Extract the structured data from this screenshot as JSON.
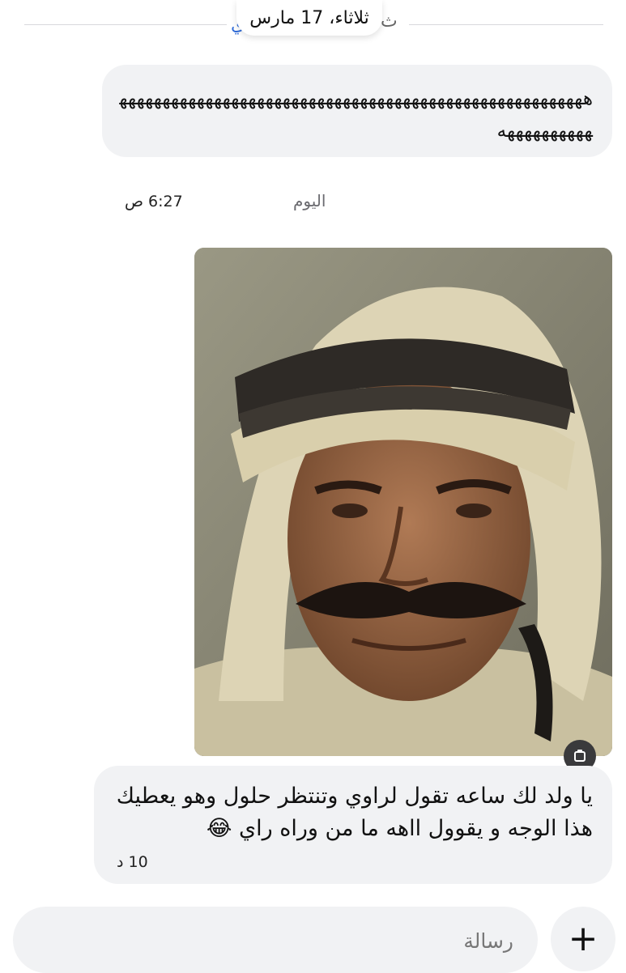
{
  "header": {
    "date_chip": "ثلاثاء، 17 مارس",
    "ghost_left": "ي",
    "ghost_right": "ث"
  },
  "messages": [
    {
      "text": "هههههههههههههههههههههههههههههههههههههههههههههههههههههههههههههههههه",
      "time": "6:27 ص"
    }
  ],
  "divider": {
    "today_label": "اليوم"
  },
  "photo_message": {
    "alt": "صورة",
    "badge_icon": "attachment-icon"
  },
  "reply": {
    "text": "يا ولد لك ساعه تقول لراوي وتنتظر حلول وهو يعطيك هذا الوجه و يقوول ااهه ما من وراه راي 😂",
    "time": "10 د"
  },
  "composer": {
    "placeholder": "رسالة",
    "plus_label": "+"
  },
  "colors": {
    "bubble": "#f1f2f4",
    "accent": "#2f6bd8"
  }
}
